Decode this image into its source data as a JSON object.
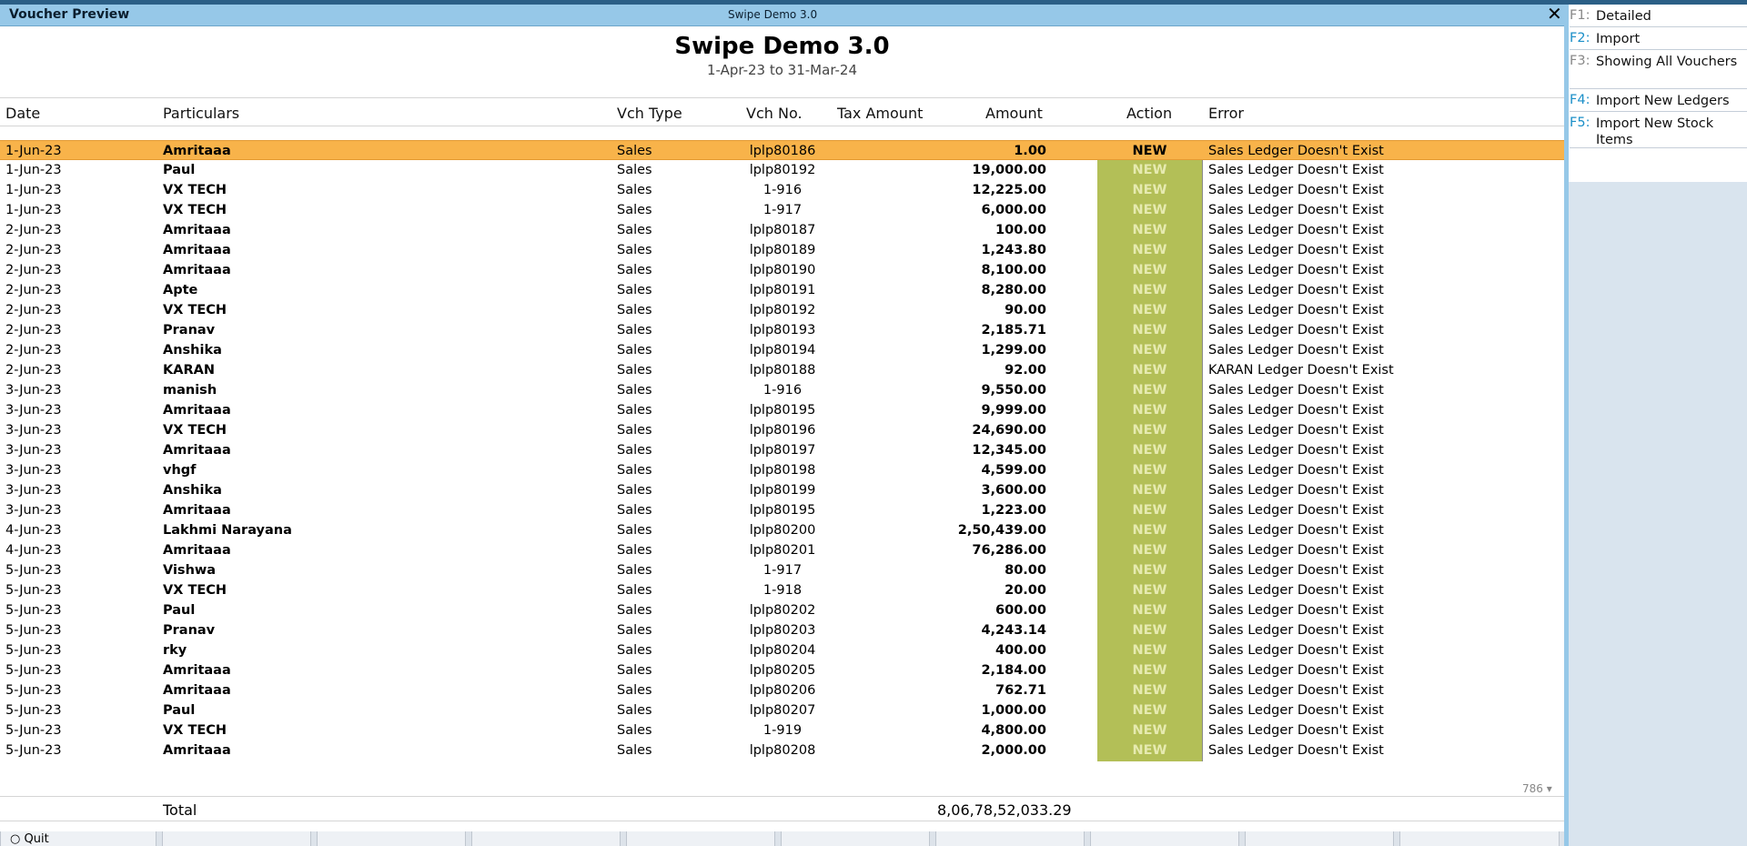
{
  "window": {
    "title": "Voucher Preview",
    "company_tag": "Swipe Demo 3.0",
    "close_glyph": "✕"
  },
  "report": {
    "company": "Swipe Demo 3.0",
    "period": "1-Apr-23 to 31-Mar-24"
  },
  "columns": {
    "date": "Date",
    "particulars": "Particulars",
    "vch_type": "Vch Type",
    "vch_no": "Vch No.",
    "tax_amount": "Tax Amount",
    "amount": "Amount",
    "action": "Action",
    "error": "Error"
  },
  "rows": [
    {
      "date": "1-Jun-23",
      "particulars": "Amritaaa",
      "vch_type": "Sales",
      "vch_no": "lplp80186",
      "amount": "1.00",
      "action": "NEW",
      "error": "Sales Ledger Doesn't Exist"
    },
    {
      "date": "1-Jun-23",
      "particulars": "Paul",
      "vch_type": "Sales",
      "vch_no": "lplp80192",
      "amount": "19,000.00",
      "action": "NEW",
      "error": "Sales Ledger Doesn't Exist"
    },
    {
      "date": "1-Jun-23",
      "particulars": "VX TECH",
      "vch_type": "Sales",
      "vch_no": "1-916",
      "amount": "12,225.00",
      "action": "NEW",
      "error": "Sales Ledger Doesn't Exist"
    },
    {
      "date": "1-Jun-23",
      "particulars": "VX TECH",
      "vch_type": "Sales",
      "vch_no": "1-917",
      "amount": "6,000.00",
      "action": "NEW",
      "error": "Sales Ledger Doesn't Exist"
    },
    {
      "date": "2-Jun-23",
      "particulars": "Amritaaa",
      "vch_type": "Sales",
      "vch_no": "lplp80187",
      "amount": "100.00",
      "action": "NEW",
      "error": "Sales Ledger Doesn't Exist"
    },
    {
      "date": "2-Jun-23",
      "particulars": "Amritaaa",
      "vch_type": "Sales",
      "vch_no": "lplp80189",
      "amount": "1,243.80",
      "action": "NEW",
      "error": "Sales Ledger Doesn't Exist"
    },
    {
      "date": "2-Jun-23",
      "particulars": "Amritaaa",
      "vch_type": "Sales",
      "vch_no": "lplp80190",
      "amount": "8,100.00",
      "action": "NEW",
      "error": "Sales Ledger Doesn't Exist"
    },
    {
      "date": "2-Jun-23",
      "particulars": "Apte",
      "vch_type": "Sales",
      "vch_no": "lplp80191",
      "amount": "8,280.00",
      "action": "NEW",
      "error": "Sales Ledger Doesn't Exist"
    },
    {
      "date": "2-Jun-23",
      "particulars": "VX TECH",
      "vch_type": "Sales",
      "vch_no": "lplp80192",
      "amount": "90.00",
      "action": "NEW",
      "error": "Sales Ledger Doesn't Exist"
    },
    {
      "date": "2-Jun-23",
      "particulars": "Pranav",
      "vch_type": "Sales",
      "vch_no": "lplp80193",
      "amount": "2,185.71",
      "action": "NEW",
      "error": "Sales Ledger Doesn't Exist"
    },
    {
      "date": "2-Jun-23",
      "particulars": "Anshika",
      "vch_type": "Sales",
      "vch_no": "lplp80194",
      "amount": "1,299.00",
      "action": "NEW",
      "error": "Sales Ledger Doesn't Exist"
    },
    {
      "date": "2-Jun-23",
      "particulars": "KARAN",
      "vch_type": "Sales",
      "vch_no": "lplp80188",
      "amount": "92.00",
      "action": "NEW",
      "error": "KARAN Ledger Doesn't Exist"
    },
    {
      "date": "3-Jun-23",
      "particulars": "manish",
      "vch_type": "Sales",
      "vch_no": "1-916",
      "amount": "9,550.00",
      "action": "NEW",
      "error": "Sales Ledger Doesn't Exist"
    },
    {
      "date": "3-Jun-23",
      "particulars": "Amritaaa",
      "vch_type": "Sales",
      "vch_no": "lplp80195",
      "amount": "9,999.00",
      "action": "NEW",
      "error": "Sales Ledger Doesn't Exist"
    },
    {
      "date": "3-Jun-23",
      "particulars": "VX TECH",
      "vch_type": "Sales",
      "vch_no": "lplp80196",
      "amount": "24,690.00",
      "action": "NEW",
      "error": "Sales Ledger Doesn't Exist"
    },
    {
      "date": "3-Jun-23",
      "particulars": "Amritaaa",
      "vch_type": "Sales",
      "vch_no": "lplp80197",
      "amount": "12,345.00",
      "action": "NEW",
      "error": "Sales Ledger Doesn't Exist"
    },
    {
      "date": "3-Jun-23",
      "particulars": "vhgf",
      "vch_type": "Sales",
      "vch_no": "lplp80198",
      "amount": "4,599.00",
      "action": "NEW",
      "error": "Sales Ledger Doesn't Exist"
    },
    {
      "date": "3-Jun-23",
      "particulars": "Anshika",
      "vch_type": "Sales",
      "vch_no": "lplp80199",
      "amount": "3,600.00",
      "action": "NEW",
      "error": "Sales Ledger Doesn't Exist"
    },
    {
      "date": "3-Jun-23",
      "particulars": "Amritaaa",
      "vch_type": "Sales",
      "vch_no": "lplp80195",
      "amount": "1,223.00",
      "action": "NEW",
      "error": "Sales Ledger Doesn't Exist"
    },
    {
      "date": "4-Jun-23",
      "particulars": "Lakhmi Narayana",
      "vch_type": "Sales",
      "vch_no": "lplp80200",
      "amount": "2,50,439.00",
      "action": "NEW",
      "error": "Sales Ledger Doesn't Exist"
    },
    {
      "date": "4-Jun-23",
      "particulars": "Amritaaa",
      "vch_type": "Sales",
      "vch_no": "lplp80201",
      "amount": "76,286.00",
      "action": "NEW",
      "error": "Sales Ledger Doesn't Exist"
    },
    {
      "date": "5-Jun-23",
      "particulars": "Vishwa",
      "vch_type": "Sales",
      "vch_no": "1-917",
      "amount": "80.00",
      "action": "NEW",
      "error": "Sales Ledger Doesn't Exist"
    },
    {
      "date": "5-Jun-23",
      "particulars": "VX TECH",
      "vch_type": "Sales",
      "vch_no": "1-918",
      "amount": "20.00",
      "action": "NEW",
      "error": "Sales Ledger Doesn't Exist"
    },
    {
      "date": "5-Jun-23",
      "particulars": "Paul",
      "vch_type": "Sales",
      "vch_no": "lplp80202",
      "amount": "600.00",
      "action": "NEW",
      "error": "Sales Ledger Doesn't Exist"
    },
    {
      "date": "5-Jun-23",
      "particulars": "Pranav",
      "vch_type": "Sales",
      "vch_no": "lplp80203",
      "amount": "4,243.14",
      "action": "NEW",
      "error": "Sales Ledger Doesn't Exist"
    },
    {
      "date": "5-Jun-23",
      "particulars": "rky",
      "vch_type": "Sales",
      "vch_no": "lplp80204",
      "amount": "400.00",
      "action": "NEW",
      "error": "Sales Ledger Doesn't Exist"
    },
    {
      "date": "5-Jun-23",
      "particulars": "Amritaaa",
      "vch_type": "Sales",
      "vch_no": "lplp80205",
      "amount": "2,184.00",
      "action": "NEW",
      "error": "Sales Ledger Doesn't Exist"
    },
    {
      "date": "5-Jun-23",
      "particulars": "Amritaaa",
      "vch_type": "Sales",
      "vch_no": "lplp80206",
      "amount": "762.71",
      "action": "NEW",
      "error": "Sales Ledger Doesn't Exist"
    },
    {
      "date": "5-Jun-23",
      "particulars": "Paul",
      "vch_type": "Sales",
      "vch_no": "lplp80207",
      "amount": "1,000.00",
      "action": "NEW",
      "error": "Sales Ledger Doesn't Exist"
    },
    {
      "date": "5-Jun-23",
      "particulars": "VX TECH",
      "vch_type": "Sales",
      "vch_no": "1-919",
      "amount": "4,800.00",
      "action": "NEW",
      "error": "Sales Ledger Doesn't Exist"
    },
    {
      "date": "5-Jun-23",
      "particulars": "Amritaaa",
      "vch_type": "Sales",
      "vch_no": "lplp80208",
      "amount": "2,000.00",
      "action": "NEW",
      "error": "Sales Ledger Doesn't Exist"
    }
  ],
  "selected_row": 0,
  "scroll_indicator": "786 ▾",
  "total": {
    "label": "Total",
    "value": "8,06,78,52,033.29"
  },
  "bottom_bar": {
    "quit_label": "Quit"
  },
  "right_panel": {
    "buttons": [
      {
        "key": "F1:",
        "label": "Detailed",
        "key_highlight": false
      },
      {
        "key": "F2:",
        "label": "Import",
        "key_highlight": true
      },
      {
        "key": "F3:",
        "label": "Showing All Vouchers",
        "key_highlight": false
      },
      {
        "key": "F4:",
        "label": "Import New Ledgers",
        "key_highlight": true
      },
      {
        "key": "F5:",
        "label": "Import New Stock Items",
        "key_highlight": true
      }
    ]
  },
  "colors": {
    "title_bar": "#96c8e8",
    "selected_row": "#f8b34a",
    "action_band": "#b3bf57",
    "key_highlight": "#1b8fc8"
  }
}
